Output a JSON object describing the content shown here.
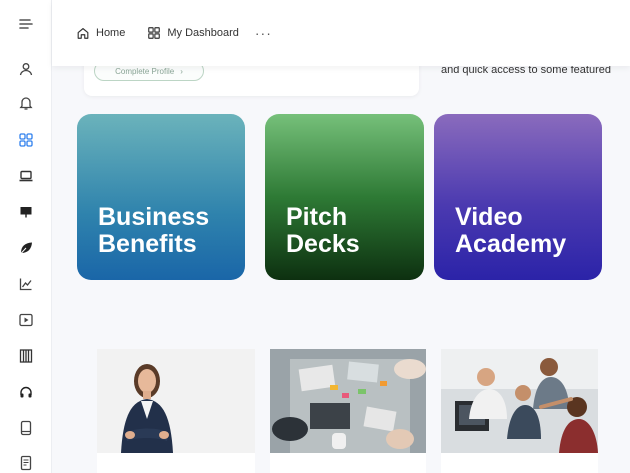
{
  "breadcrumb": {
    "home_label": "Home",
    "dashboard_label": "My Dashboard",
    "more_label": "···"
  },
  "profile": {
    "complete_label": "Complete Profile",
    "chevron": "›"
  },
  "side_text": "and quick access to some featured",
  "cards": {
    "business": "Business\nBenefits",
    "pitch": "Pitch\nDecks",
    "video": "Video\nAcademy"
  },
  "sidebar_icons": [
    "menu-icon",
    "user-icon",
    "bell-icon",
    "grid-icon",
    "laptop-icon",
    "presentation-icon",
    "leaf-icon",
    "chart-icon",
    "play-icon",
    "piano-icon",
    "headphones-icon",
    "tablet-icon",
    "document-icon"
  ],
  "colors": {
    "accent": "#2f80ed",
    "business_start": "#6bb3bb",
    "business_end": "#1a66a8",
    "pitch_start": "#76c07a",
    "pitch_end": "#0d3010",
    "video_start": "#8a6bbd",
    "video_end": "#2b23a8"
  }
}
